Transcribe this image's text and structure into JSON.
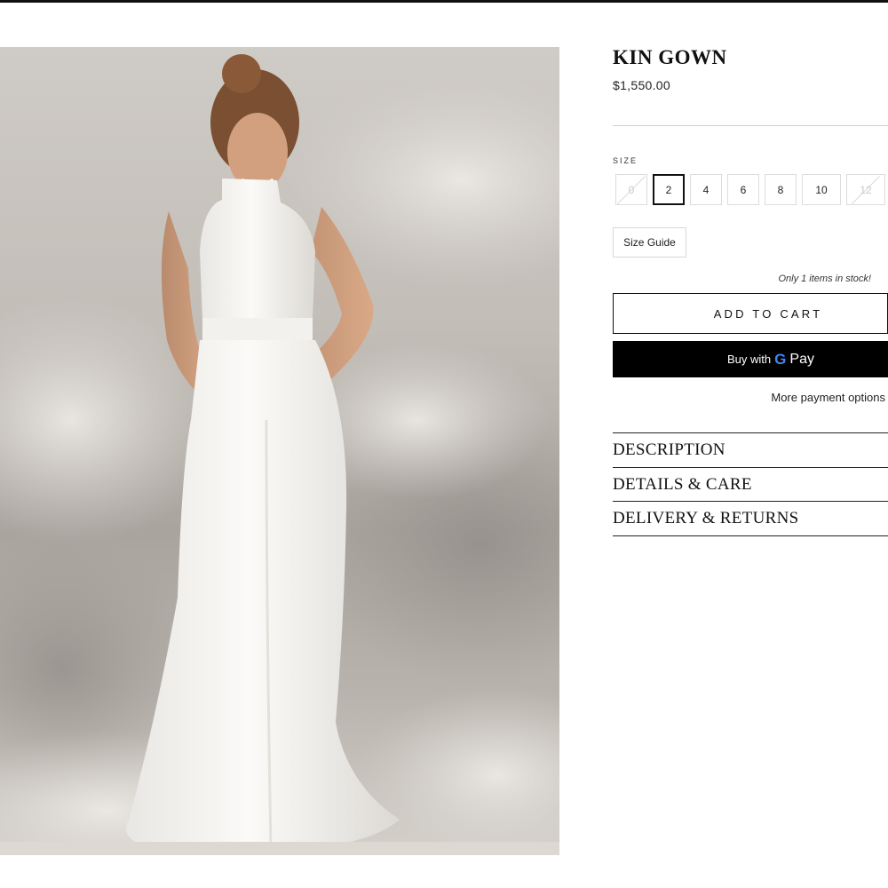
{
  "product": {
    "title": "KIN GOWN",
    "price": "$1,550.00",
    "image_alt": "Model wearing a white halter-neck satin gown against a cloudy backdrop"
  },
  "size": {
    "label": "SIZE",
    "options": [
      {
        "label": "0",
        "state": "unavailable"
      },
      {
        "label": "2",
        "state": "selected"
      },
      {
        "label": "4",
        "state": "available"
      },
      {
        "label": "6",
        "state": "available"
      },
      {
        "label": "8",
        "state": "available"
      },
      {
        "label": "10",
        "state": "available"
      },
      {
        "label": "12",
        "state": "unavailable"
      }
    ],
    "guide_label": "Size Guide"
  },
  "stock_note": "Only 1 items in stock!",
  "actions": {
    "add_to_cart": "ADD TO CART",
    "gpay_prefix": "Buy with",
    "gpay_g": "G",
    "gpay_word": "Pay",
    "more_payment": "More payment options"
  },
  "accordion": [
    {
      "label": "DESCRIPTION"
    },
    {
      "label": "DETAILS & CARE"
    },
    {
      "label": "DELIVERY & RETURNS"
    }
  ],
  "colors": {
    "text": "#111111",
    "button_dark": "#000000",
    "google_blue": "#4285f4",
    "border_light": "#dcdcdc"
  }
}
